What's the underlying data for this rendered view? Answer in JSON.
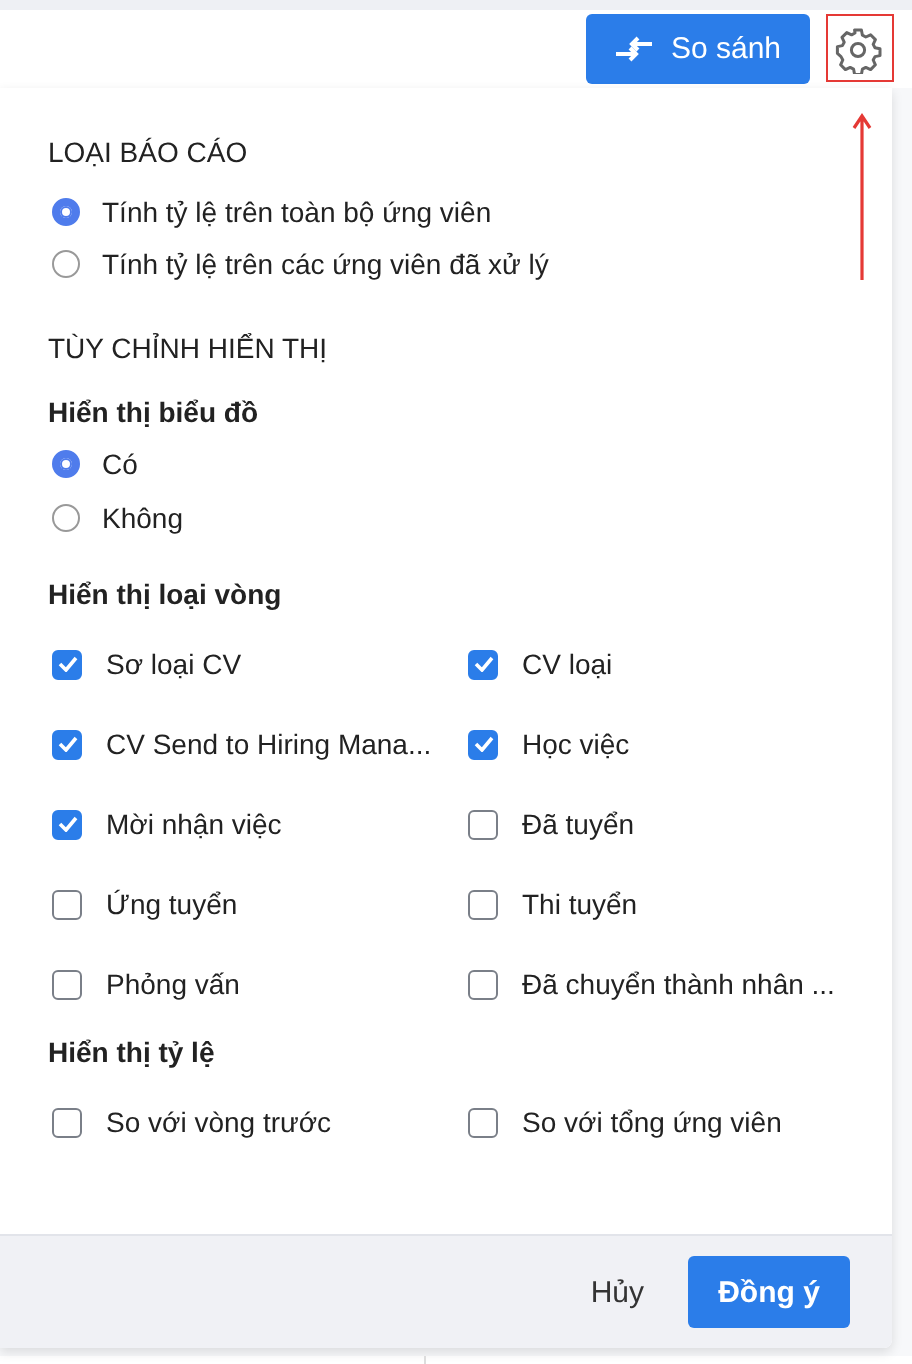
{
  "header": {
    "compare_button": "So sánh"
  },
  "report_type": {
    "title": "LOẠI BÁO CÁO",
    "options": [
      {
        "label": "Tính tỷ lệ trên toàn bộ ứng viên",
        "selected": true
      },
      {
        "label": "Tính tỷ lệ trên các ứng viên đã xử lý",
        "selected": false
      }
    ]
  },
  "display": {
    "title": "TÙY CHỈNH HIỂN THỊ",
    "chart": {
      "title": "Hiển thị biểu đồ",
      "options": [
        {
          "label": "Có",
          "selected": true
        },
        {
          "label": "Không",
          "selected": false
        }
      ]
    },
    "rounds": {
      "title": "Hiển thị loại vòng",
      "items": [
        {
          "label": "Sơ loại CV",
          "checked": true
        },
        {
          "label": "CV loại",
          "checked": true
        },
        {
          "label": "CV Send to Hiring Mana...",
          "checked": true
        },
        {
          "label": "Học việc",
          "checked": true
        },
        {
          "label": "Mời nhận việc",
          "checked": true
        },
        {
          "label": "Đã tuyển",
          "checked": false
        },
        {
          "label": "Ứng tuyển",
          "checked": false
        },
        {
          "label": "Thi tuyển",
          "checked": false
        },
        {
          "label": "Phỏng vấn",
          "checked": false
        },
        {
          "label": "Đã chuyển thành nhân ...",
          "checked": false
        }
      ]
    },
    "ratio": {
      "title": "Hiển thị tỷ lệ",
      "items": [
        {
          "label": "So với vòng trước",
          "checked": false
        },
        {
          "label": "So với tổng ứng viên",
          "checked": false
        }
      ]
    }
  },
  "footer": {
    "cancel": "Hủy",
    "confirm": "Đồng ý"
  }
}
